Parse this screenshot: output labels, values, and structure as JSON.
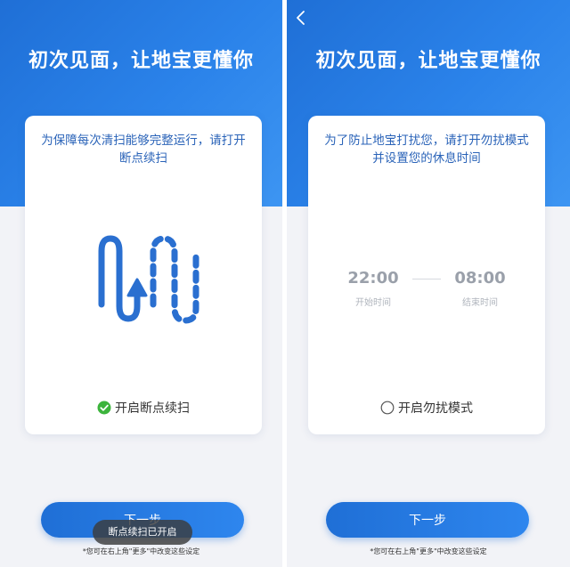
{
  "colors": {
    "accent": "#1f6fd6",
    "description_text": "#2a63b8",
    "check_green": "#3cb43c",
    "background": "#f2f3f7"
  },
  "screen_left": {
    "title": "初次见面，让地宝更懂你",
    "description": "为保障每次清扫能够完整运行，请打开断点续扫",
    "illustration_icon": "resume-path-arrow-icon",
    "toggle": {
      "label": "开启断点续扫",
      "checked": true,
      "icon": "check-circle-icon"
    },
    "next_button_label": "下一步",
    "footnote": "*您可在右上角\"更多\"中改变这些设定",
    "toast": "断点续扫已开启"
  },
  "screen_right": {
    "back_icon": "chevron-left-icon",
    "title": "初次见面，让地宝更懂你",
    "description": "为了防止地宝打扰您，请打开勿扰模式并设置您的休息时间",
    "start_time": {
      "value": "22:00",
      "caption": "开始时间"
    },
    "end_time": {
      "value": "08:00",
      "caption": "结束时间"
    },
    "toggle": {
      "label": "开启勿扰模式",
      "checked": false,
      "icon": "radio-empty-icon"
    },
    "next_button_label": "下一步",
    "footnote": "*您可在右上角\"更多\"中改变这些设定"
  }
}
